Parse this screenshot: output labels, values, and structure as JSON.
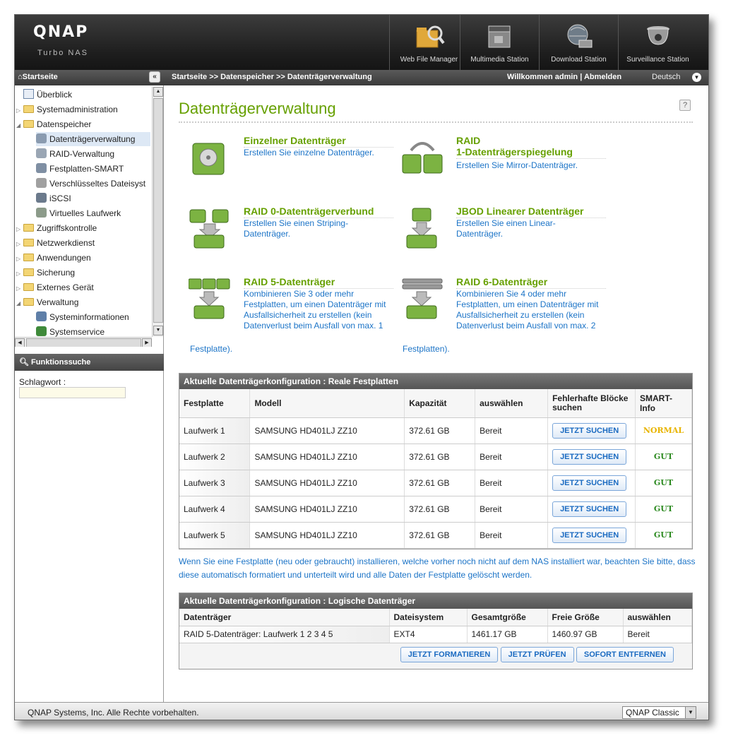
{
  "brand": {
    "logo": "QNAP",
    "tagline": "Turbo NAS"
  },
  "apps": [
    {
      "label": "Web File Manager",
      "icon": "folder-magnifier-icon"
    },
    {
      "label": "Multimedia Station",
      "icon": "film-clapper-icon"
    },
    {
      "label": "Download Station",
      "icon": "globe-download-icon"
    },
    {
      "label": "Surveillance Station",
      "icon": "dome-camera-icon"
    }
  ],
  "topbar": {
    "home": "Startseite",
    "collapse": "«",
    "breadcrumb": "Startseite >> Datenspeicher >> Datenträgerverwaltung",
    "welcome": "Willkommen admin",
    "separator": " | ",
    "logout": "Abmelden",
    "language": "Deutsch"
  },
  "tree": [
    {
      "label": "Überblick"
    },
    {
      "label": "Systemadministration"
    },
    {
      "label": "Datenspeicher"
    },
    {
      "label": "Datenträgerverwaltung"
    },
    {
      "label": "RAID-Verwaltung"
    },
    {
      "label": "Festplatten-SMART"
    },
    {
      "label": "Verschlüsseltes Dateisyst"
    },
    {
      "label": "iSCSI"
    },
    {
      "label": "Virtuelles Laufwerk"
    },
    {
      "label": "Zugriffskontrolle"
    },
    {
      "label": "Netzwerkdienst"
    },
    {
      "label": "Anwendungen"
    },
    {
      "label": "Sicherung"
    },
    {
      "label": "Externes Gerät"
    },
    {
      "label": "Verwaltung"
    },
    {
      "label": "Systeminformationen"
    },
    {
      "label": "Systemservice"
    }
  ],
  "search": {
    "title": "Funktionssuche",
    "keyword_label": "Schlagwort :",
    "value": ""
  },
  "page": {
    "title": "Datenträgerverwaltung",
    "help": "?"
  },
  "options": [
    {
      "title": "Einzelner Datenträger",
      "desc": "Erstellen Sie einzelne Datenträger.",
      "tail": ""
    },
    {
      "title": "RAID\n1-Datenträgerspiegelung",
      "desc": "Erstellen Sie Mirror-Datenträger.",
      "tail": ""
    },
    {
      "title": "RAID 0-Datenträgerverbund",
      "desc": "Erstellen Sie einen Striping-\nDatenträger.",
      "tail": ""
    },
    {
      "title": "JBOD Linearer Datenträger",
      "desc": "Erstellen Sie einen Linear-\nDatenträger.",
      "tail": ""
    },
    {
      "title": "RAID 5-Datenträger",
      "desc": "Kombinieren Sie 3 oder mehr\nFestplatten, um einen Datenträger mit\nAusfallsicherheit zu erstellen (kein\nDatenverlust beim Ausfall von max. 1",
      "tail": "Festplatte)."
    },
    {
      "title": "RAID 6-Datenträger",
      "desc": "Kombinieren Sie 4 oder mehr\nFestplatten, um einen Datenträger mit\nAusfallsicherheit zu erstellen (kein\nDatenverlust beim Ausfall von max. 2",
      "tail": "Festplatten)."
    }
  ],
  "physical": {
    "title": "Aktuelle Datenträgerkonfiguration : Reale Festplatten",
    "headers": [
      "Festplatte",
      "Modell",
      "Kapazität",
      "auswählen",
      "Fehlerhafte Blöcke suchen",
      "SMART-Info"
    ],
    "rows": [
      {
        "disk": "Laufwerk 1",
        "model": "SAMSUNG HD401LJ ZZ10",
        "capacity": "372.61 GB",
        "status": "Bereit",
        "action": "JETZT SUCHEN",
        "smart": "NORMAL",
        "smart_color": "#e8b400"
      },
      {
        "disk": "Laufwerk 2",
        "model": "SAMSUNG HD401LJ ZZ10",
        "capacity": "372.61 GB",
        "status": "Bereit",
        "action": "JETZT SUCHEN",
        "smart": "GUT",
        "smart_color": "#2e8b22"
      },
      {
        "disk": "Laufwerk 3",
        "model": "SAMSUNG HD401LJ ZZ10",
        "capacity": "372.61 GB",
        "status": "Bereit",
        "action": "JETZT SUCHEN",
        "smart": "GUT",
        "smart_color": "#2e8b22"
      },
      {
        "disk": "Laufwerk 4",
        "model": "SAMSUNG HD401LJ ZZ10",
        "capacity": "372.61 GB",
        "status": "Bereit",
        "action": "JETZT SUCHEN",
        "smart": "GUT",
        "smart_color": "#2e8b22"
      },
      {
        "disk": "Laufwerk 5",
        "model": "SAMSUNG HD401LJ ZZ10",
        "capacity": "372.61 GB",
        "status": "Bereit",
        "action": "JETZT SUCHEN",
        "smart": "GUT",
        "smart_color": "#2e8b22"
      }
    ]
  },
  "note": "Wenn Sie eine Festplatte (neu oder gebraucht) installieren, welche vorher noch nicht auf dem NAS installiert war, beachten Sie bitte, dass diese automatisch formatiert und unterteilt wird und alle Daten der Festplatte gelöscht werden.",
  "logical": {
    "title": "Aktuelle Datenträgerkonfiguration : Logische Datenträger",
    "headers": [
      "Datenträger",
      "Dateisystem",
      "Gesamtgröße",
      "Freie Größe",
      "auswählen"
    ],
    "rows": [
      {
        "volume": "RAID 5-Datenträger: Laufwerk 1 2 3 4 5",
        "fs": "EXT4",
        "total": "1461.17 GB",
        "free": "1460.97 GB",
        "status": "Bereit"
      }
    ],
    "buttons": [
      "JETZT FORMATIEREN",
      "JETZT PRÜFEN",
      "SOFORT ENTFERNEN"
    ]
  },
  "footer": {
    "copyright": "QNAP Systems, Inc. Alle Rechte vorbehalten.",
    "theme": "QNAP Classic"
  },
  "colors": {
    "accent_green": "#66a000",
    "link_blue": "#1c74c7"
  }
}
